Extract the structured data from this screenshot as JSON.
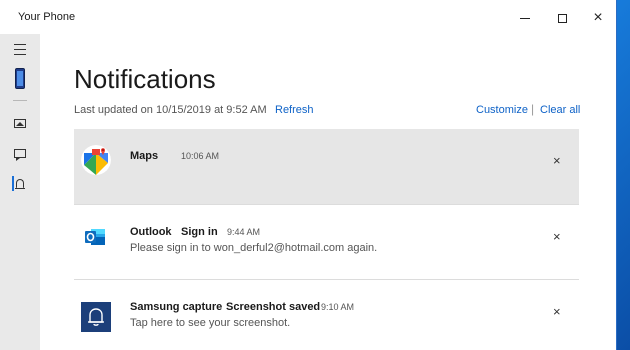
{
  "window": {
    "app_title": "Your Phone"
  },
  "controls": {
    "minimize": "minimize",
    "maximize": "maximize",
    "close": "close"
  },
  "sidebar": {
    "items": [
      {
        "name": "menu",
        "icon": "hamburger-icon"
      },
      {
        "name": "phone",
        "icon": "phone-icon"
      },
      {
        "name": "photos",
        "icon": "photos-icon"
      },
      {
        "name": "messages",
        "icon": "messages-icon"
      },
      {
        "name": "notifications",
        "icon": "bell-icon",
        "selected": true
      }
    ]
  },
  "page": {
    "title": "Notifications",
    "updated": "Last updated on 10/15/2019 at 9:52 AM",
    "refresh": "Refresh",
    "customize": "Customize",
    "separator": "|",
    "clear_all": "Clear all"
  },
  "notifications": [
    {
      "app": "Maps",
      "title": "",
      "time": "10:06 AM",
      "body": "",
      "icon": "google-maps-icon",
      "close": "×"
    },
    {
      "app": "Outlook",
      "title": "Sign in",
      "time": "9:44 AM",
      "body": "Please sign in to won_derful2@hotmail.com again.",
      "icon": "outlook-icon",
      "close": "×"
    },
    {
      "app": "Samsung capture",
      "title": "Screenshot saved",
      "time": "9:10 AM",
      "body": "Tap here to see your screenshot.",
      "icon": "bell-icon",
      "close": "×"
    }
  ],
  "colors": {
    "accent": "#0e62c7",
    "selected_bg": "#e6e6e6",
    "sidebar_bg": "#e9e9e9",
    "capture_bg": "#1c3f7a"
  }
}
